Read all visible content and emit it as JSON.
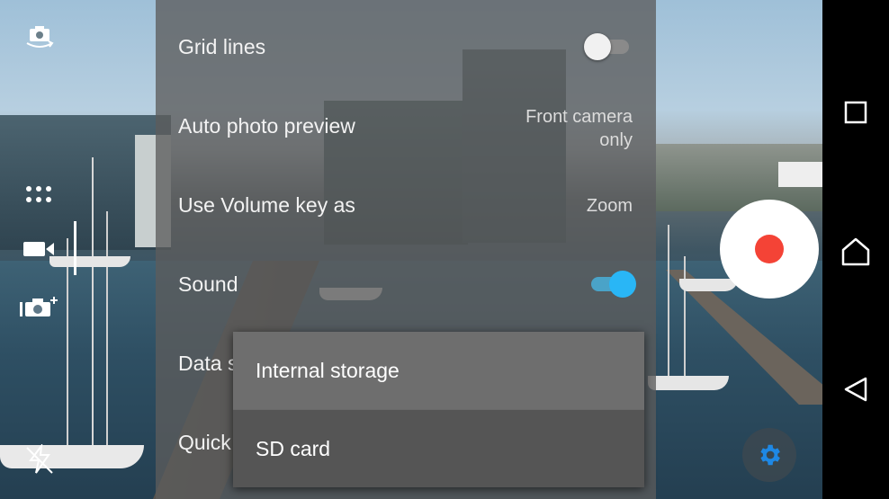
{
  "settings": {
    "items": [
      {
        "label": "Grid lines",
        "value": ""
      },
      {
        "label": "Auto photo preview",
        "value": "Front camera\nonly"
      },
      {
        "label": "Use Volume key as",
        "value": "Zoom"
      },
      {
        "label": "Sound",
        "value": ""
      },
      {
        "label": "Data s",
        "value": ""
      },
      {
        "label": "Quick",
        "value": ""
      }
    ],
    "grid_lines_on": false,
    "sound_on": true
  },
  "storage_popup": {
    "options": [
      "Internal storage",
      "SD card"
    ]
  },
  "colors": {
    "accent": "#29b6f6",
    "record": "#f44336",
    "settings_gear": "#1e88e5"
  },
  "icons": {
    "camera_switch": "camera-switch-icon",
    "modes": "modes-grid-icon",
    "video_mode": "video-mode-icon",
    "photo_add": "photo-add-icon",
    "flash_off": "flash-off-icon",
    "settings": "gear-icon",
    "record": "record-icon",
    "nav_recents": "recents-icon",
    "nav_home": "home-icon",
    "nav_back": "back-icon"
  }
}
